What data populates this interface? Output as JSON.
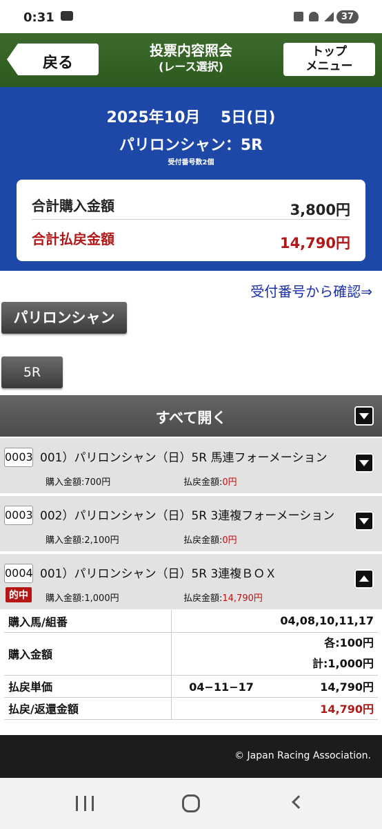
{
  "status_bar": {
    "time": "0:31",
    "battery": "37"
  },
  "header": {
    "back_label": "戻る",
    "title_line1": "投票内容照会",
    "title_line2": "(レース選択)",
    "top_menu_line1": "トップ",
    "top_menu_line2": "メニュー"
  },
  "race": {
    "date": "2025年10月　 5日(日)",
    "name": "パリロンシャン：5R",
    "sub": "受付番号数2個"
  },
  "totals": {
    "purchase_label": "合計購入金額",
    "purchase_value": "3,800円",
    "payout_label": "合計払戻金額",
    "payout_value": "14,790円"
  },
  "confirm_link": "受付番号から確認⇒",
  "venue_button": "パリロンシャン",
  "race_button": "5R",
  "open_all_label": "すべて開く",
  "tickets": [
    {
      "number": "0003",
      "title": "001）パリロンシャン（日）5R 馬連フォーメーション",
      "buy": "購入金額:700円",
      "pay_label": "払戻金額:",
      "pay_value": "0円"
    },
    {
      "number": "0003",
      "title": "002）パリロンシャン（日）5R 3連複フォーメーション",
      "buy": "購入金額:2,100円",
      "pay_label": "払戻金額:",
      "pay_value": "0円"
    },
    {
      "number": "0004",
      "title": "001）パリロンシャン（日）5R 3連複ＢＯＸ",
      "badge": "的中",
      "buy": "購入金額:1,000円",
      "pay_label": "払戻金額:",
      "pay_value": "14,790円"
    }
  ],
  "detail": {
    "combo_label": "購入馬/組番",
    "combo_value": "04,08,10,11,17",
    "amount_label": "購入金額",
    "amount_each": "各:100円",
    "amount_total": "計:1,000円",
    "unit_label": "払戻単価",
    "unit_combo": "04−11−17",
    "unit_value": "14,790円",
    "refund_label": "払戻/返還金額",
    "refund_value": "14,790円"
  },
  "footer": {
    "copyright": "© Japan Racing Association."
  },
  "colors": {
    "header_green": "#2c5a1e",
    "race_blue": "#1e48a8",
    "payout_red": "#b11818"
  }
}
